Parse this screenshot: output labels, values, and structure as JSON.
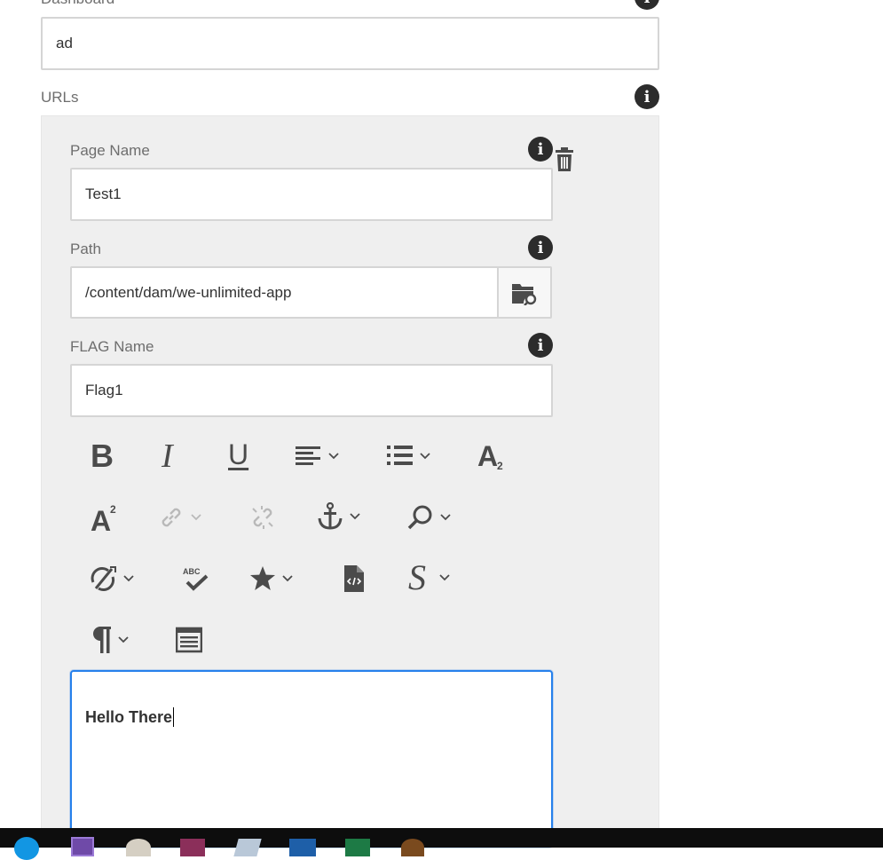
{
  "fields": {
    "dashboard": {
      "label": "Dashboard",
      "value": "ad"
    },
    "urls_label": "URLs",
    "page_name": {
      "label": "Page Name",
      "value": "Test1"
    },
    "path": {
      "label": "Path",
      "value": "/content/dam/we-unlimited-app"
    },
    "flag_name": {
      "label": "FLAG Name",
      "value": "Flag1"
    }
  },
  "info_glyph": "i",
  "rte": {
    "toolbar": [
      {
        "name": "bold-icon",
        "glyph": "B"
      },
      {
        "name": "italic-icon",
        "glyph": "I"
      },
      {
        "name": "underline-icon",
        "glyph": "U"
      },
      {
        "name": "align-icon"
      },
      {
        "name": "list-icon"
      },
      {
        "name": "subscript-icon"
      },
      {
        "name": "superscript-icon"
      },
      {
        "name": "link-icon"
      },
      {
        "name": "unlink-icon"
      },
      {
        "name": "anchor-icon"
      },
      {
        "name": "find-replace-icon"
      },
      {
        "name": "spellcheck-settings-icon"
      },
      {
        "name": "spellcheck-icon"
      },
      {
        "name": "special-characters-icon"
      },
      {
        "name": "source-edit-icon"
      },
      {
        "name": "styles-icon"
      },
      {
        "name": "paragraph-format-icon"
      },
      {
        "name": "table-icon"
      }
    ],
    "content": "Hello There"
  },
  "taskbar_icons": [
    "skype-icon",
    "visual-studio-icon",
    "paint-icon",
    "winrar-icon",
    "notepad-icon",
    "remote-desktop-icon",
    "excel-icon",
    "app-icon"
  ]
}
